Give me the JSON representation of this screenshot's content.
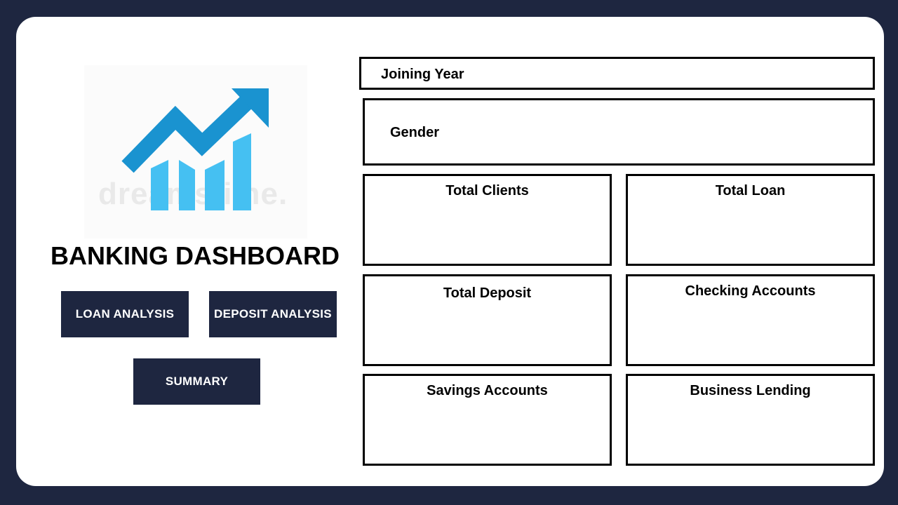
{
  "logo": {
    "icon": "rising-chart-arrow-icon",
    "watermark": "dreamstime."
  },
  "title": "BANKING DASHBOARD",
  "nav": {
    "loan_analysis": "LOAN ANALYSIS",
    "deposit_analysis": "DEPOSIT ANALYSIS",
    "summary": "SUMMARY"
  },
  "slicers": {
    "joining_year": "Joining Year",
    "gender": "Gender"
  },
  "cards": [
    {
      "label": "Total Clients"
    },
    {
      "label": "Total Loan"
    },
    {
      "label": "Total Deposit"
    },
    {
      "label": "Checking Accounts"
    },
    {
      "label": "Savings Accounts"
    },
    {
      "label": "Business Lending"
    }
  ],
  "colors": {
    "background": "#1e2640",
    "button": "#1e2640",
    "logo_dark_blue": "#1a93d0",
    "logo_light_blue": "#45c0f2"
  }
}
